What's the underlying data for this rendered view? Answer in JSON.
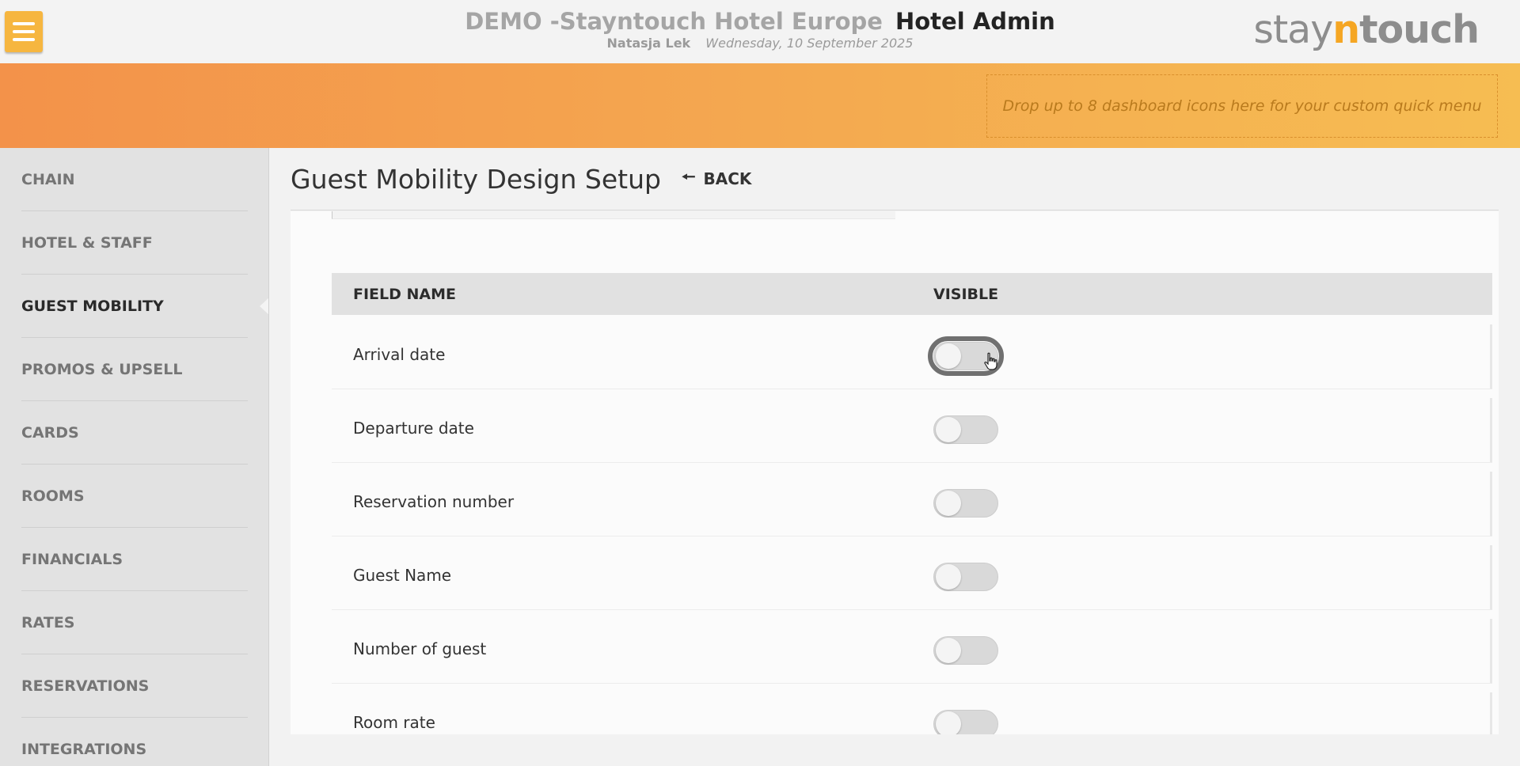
{
  "header": {
    "hotel_name": "DEMO -Stayntouch Hotel Europe",
    "app_name": "Hotel Admin",
    "user_name": "Natasja Lek",
    "date": "Wednesday, 10 September 2025",
    "logo": {
      "part1": "stay",
      "part2": "n",
      "part3": "touch"
    }
  },
  "banner": {
    "dropzone_text": "Drop up to 8 dashboard icons here for your custom quick menu"
  },
  "sidebar": {
    "items": [
      {
        "label": "CHAIN"
      },
      {
        "label": "HOTEL & STAFF"
      },
      {
        "label": "GUEST MOBILITY"
      },
      {
        "label": "PROMOS & UPSELL"
      },
      {
        "label": "CARDS"
      },
      {
        "label": "ROOMS"
      },
      {
        "label": "FINANCIALS"
      },
      {
        "label": "RATES"
      },
      {
        "label": "RESERVATIONS"
      },
      {
        "label": "INTEGRATIONS"
      }
    ],
    "active": "GUEST MOBILITY"
  },
  "page": {
    "title": "Guest Mobility Design Setup",
    "back_label": "BACK"
  },
  "table": {
    "headers": {
      "field_name": "FIELD NAME",
      "visible": "VISIBLE"
    },
    "rows": [
      {
        "label": "Arrival date",
        "visible": false
      },
      {
        "label": "Departure date",
        "visible": false
      },
      {
        "label": "Reservation number",
        "visible": false
      },
      {
        "label": "Guest Name",
        "visible": false
      },
      {
        "label": "Number of guest",
        "visible": false
      },
      {
        "label": "Room rate",
        "visible": false
      }
    ]
  },
  "colors": {
    "accent": "#f5a623",
    "menu_button": "#f6b640",
    "banner_start": "#f3924a",
    "banner_end": "#f6bd52"
  },
  "icons": {
    "menu": "hamburger-icon",
    "back": "arrow-left-icon",
    "cursor": "hand-pointer-icon"
  }
}
